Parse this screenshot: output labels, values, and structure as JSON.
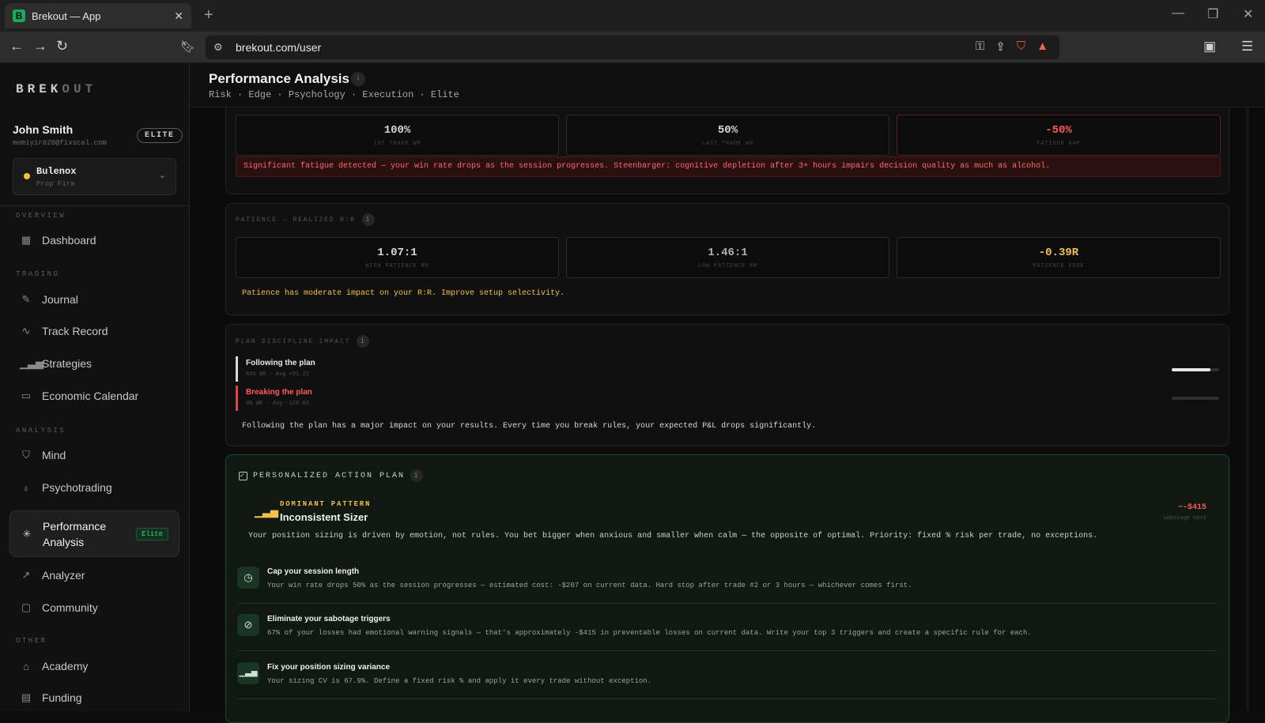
{
  "browser": {
    "tab_title": "Brekout — App",
    "tab_favicon": "B",
    "url": "brekout.com/user"
  },
  "sidebar": {
    "logo_bright": "BREK",
    "logo_dim": "OUT",
    "user": {
      "name": "John Smith",
      "email": "momiyir628@fixscal.com",
      "badge": "ELITE"
    },
    "firm": {
      "name": "Bulenox",
      "type": "Prop Firm"
    },
    "sections": {
      "overview": "OVERVIEW",
      "trading": "TRADING",
      "analysis": "ANALYSIS",
      "other": "OTHER"
    },
    "items": {
      "dashboard": "Dashboard",
      "journal": "Journal",
      "track_record": "Track Record",
      "strategies": "Strategies",
      "economic_calendar": "Economic Calendar",
      "mind": "Mind",
      "psychotrading": "Psychotrading",
      "performance_analysis": "Performance Analysis",
      "performance_tag": "Elite",
      "analyzer": "Analyzer",
      "community": "Community",
      "academy": "Academy",
      "funding": "Funding"
    }
  },
  "header": {
    "title": "Performance Analysis",
    "breadcrumbs": "Risk · Edge · Psychology · Execution · Elite"
  },
  "fatigue": {
    "stats": [
      {
        "value": "100%",
        "label": "1ST TRADE WR"
      },
      {
        "value": "50%",
        "label": "LAST TRADE WR"
      },
      {
        "value": "-50%",
        "label": "FATIGUE GAP"
      }
    ],
    "alert": "Significant fatigue detected — your win rate drops as the session progresses. Steenbarger: cognitive depletion after 3+ hours impairs decision quality as much as alcohol."
  },
  "patience": {
    "label": "PATIENCE → REALIZED R:R",
    "stats": [
      {
        "value": "1.07:1",
        "label": "HIGH PATIENCE RR"
      },
      {
        "value": "1.46:1",
        "label": "LOW PATIENCE RR"
      },
      {
        "value": "-0.39R",
        "label": "PATIENCE EDGE"
      }
    ],
    "note": "Patience has moderate impact on your R:R. Improve setup selectivity."
  },
  "discipline": {
    "label": "PLAN DISCIPLINE IMPACT",
    "following": {
      "title": "Following the plan",
      "sub": "81% WR · Avg +91.22",
      "win_rate_pct": 81
    },
    "breaking": {
      "title": "Breaking the plan",
      "sub": "0% WR · Avg -128.83",
      "win_rate_pct": 0
    },
    "note": "Following the plan has a major impact on your results. Every time you break rules, your expected P&L drops significantly."
  },
  "action_plan": {
    "title": "PERSONALIZED ACTION PLAN",
    "dominant_label": "DOMINANT PATTERN",
    "dominant_name": "Inconsistent Sizer",
    "cost": "~-$415",
    "cost_label": "sabotage cost",
    "description": "Your position sizing is driven by emotion, not rules. You bet bigger when anxious and smaller when calm — the opposite of optimal. Priority: fixed % risk per trade, no exceptions.",
    "steps": [
      {
        "icon": "clock-icon",
        "title": "Cap your session length",
        "desc": "Your win rate drops 50% as the session progresses — estimated cost: -$207 on current data. Hard stop after trade #2 or 3 hours — whichever comes first."
      },
      {
        "icon": "ban-icon",
        "title": "Eliminate your sabotage triggers",
        "desc": "67% of your losses had emotional warning signals — that's approximately -$415 in preventable losses on current data. Write your top 3 triggers and create a specific rule for each."
      },
      {
        "icon": "bar-chart-icon",
        "title": "Fix your position sizing variance",
        "desc": "Your sizing CV is 67.9%. Define a fixed risk % and apply it every trade without exception."
      }
    ]
  },
  "colors": {
    "accent_green": "#4cc982",
    "alert_red": "#ff5a5a",
    "gold": "#f3c04a"
  }
}
